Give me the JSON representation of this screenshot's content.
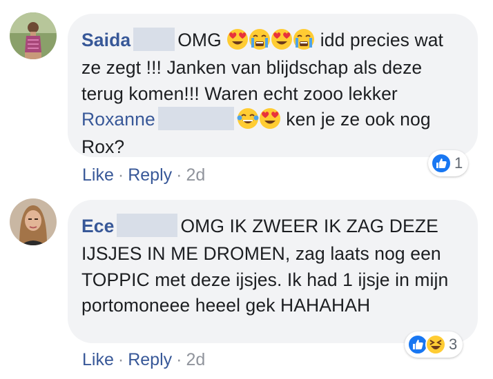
{
  "comments": [
    {
      "author": "Saida",
      "text_1": "OMG",
      "text_2": "idd precies wat ze zegt !!! Janken van blijdschap als deze terug komen!!! Waren echt zooo lekker",
      "mention": "Roxanne",
      "text_3": "ken je ze ook nog Rox?",
      "reaction_count": "1",
      "like_label": "Like",
      "reply_label": "Reply",
      "timestamp": "2d",
      "reaction_icons": [
        "like-icon"
      ]
    },
    {
      "author": "Ece",
      "text_1": "OMG IK ZWEER IK ZAG DEZE IJSJES IN ME DROMEN, zag laats nog een TOPPIC met deze ijsjes. Ik had 1 ijsje in mijn portomoneee heeel gek HAHAHAH",
      "reaction_count": "3",
      "like_label": "Like",
      "reply_label": "Reply",
      "timestamp": "2d",
      "reaction_icons": [
        "like-icon",
        "haha-icon"
      ]
    }
  ],
  "emoji": {
    "comment_1_omg": [
      "heart-eyes-emoji",
      "crying-emoji",
      "heart-eyes-emoji",
      "crying-emoji"
    ],
    "comment_1_mention": [
      "tears-of-joy-emoji",
      "heart-eyes-emoji"
    ]
  },
  "colors": {
    "link": "#385898",
    "bubble": "#f2f3f5",
    "redaction": "#d8dee8",
    "like_blue": "#1877f2",
    "emoji_yellow": "#ffcc33"
  },
  "separator": "·"
}
